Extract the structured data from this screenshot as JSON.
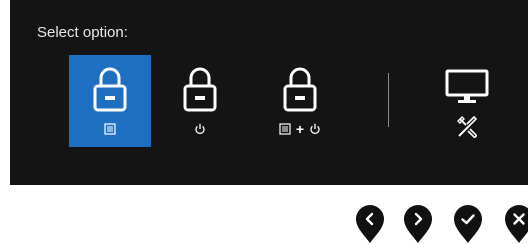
{
  "dialog": {
    "title": "Select option:",
    "selected_index": 0
  },
  "options": [
    {
      "id": "menu-lock",
      "icons": [
        "lock-icon",
        "menu-icon"
      ]
    },
    {
      "id": "power-lock",
      "icons": [
        "lock-icon",
        "power-icon"
      ]
    },
    {
      "id": "menu-power-lock",
      "icons": [
        "lock-icon",
        "menu-icon",
        "power-icon"
      ],
      "joiner": "+"
    },
    {
      "id": "diagnostics",
      "icons": [
        "monitor-icon",
        "tools-icon"
      ]
    }
  ],
  "nav_buttons": [
    {
      "icon": "chevron-left-icon"
    },
    {
      "icon": "chevron-right-icon"
    },
    {
      "icon": "check-icon"
    },
    {
      "icon": "close-icon"
    }
  ],
  "colors": {
    "osd_background": "#141414",
    "selected": "#1e6fc2",
    "foreground": "#ffffff",
    "nav_button": "#111111"
  }
}
